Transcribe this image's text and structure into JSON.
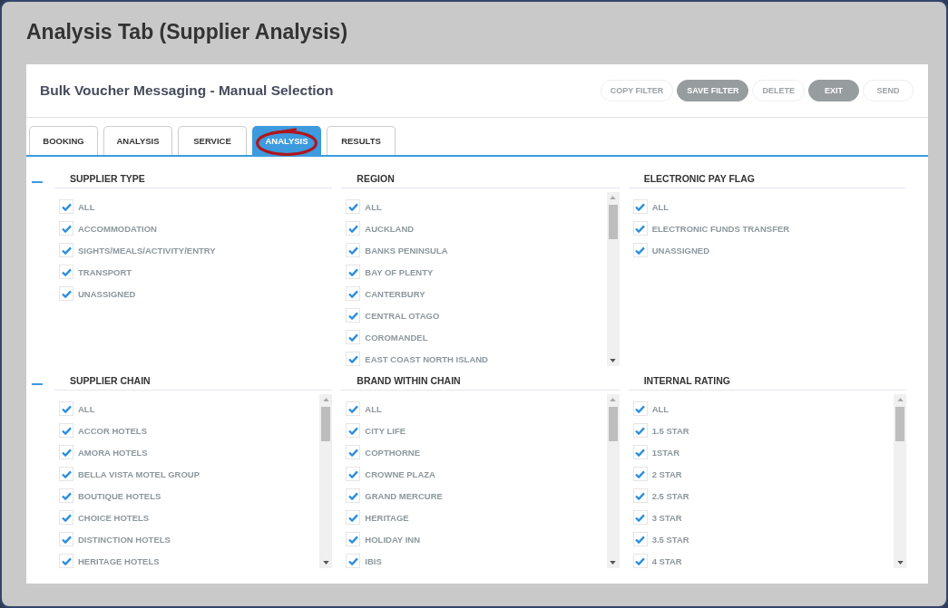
{
  "page_title": "Analysis Tab (Supplier Analysis)",
  "header": {
    "title": "Bulk Voucher Messaging - Manual Selection",
    "buttons": [
      {
        "label": "COPY FILTER",
        "disabled": true
      },
      {
        "label": "SAVE FILTER",
        "disabled": false
      },
      {
        "label": "DELETE",
        "disabled": true
      },
      {
        "label": "EXIT",
        "disabled": false
      },
      {
        "label": "SEND",
        "disabled": true
      }
    ]
  },
  "tabs": [
    {
      "label": "BOOKING",
      "selected": false,
      "circled": false
    },
    {
      "label": "ANALYSIS",
      "selected": false,
      "circled": false
    },
    {
      "label": "SERVICE",
      "selected": false,
      "circled": false
    },
    {
      "label": "ANALYSIS",
      "selected": true,
      "circled": true
    },
    {
      "label": "RESULTS",
      "selected": false,
      "circled": false
    }
  ],
  "sections": [
    {
      "expanded": true,
      "groups": [
        {
          "title": "SUPPLIER TYPE",
          "scrollable": false,
          "items": [
            {
              "label": "ALL",
              "checked": true
            },
            {
              "label": "ACCOMMODATION",
              "checked": true
            },
            {
              "label": "SIGHTS/MEALS/ACTIVITY/ENTRY",
              "checked": true
            },
            {
              "label": "TRANSPORT",
              "checked": true
            },
            {
              "label": "UNASSIGNED",
              "checked": true
            }
          ]
        },
        {
          "title": "REGION",
          "scrollable": true,
          "items": [
            {
              "label": "ALL",
              "checked": true
            },
            {
              "label": "AUCKLAND",
              "checked": true
            },
            {
              "label": "BANKS PENINSULA",
              "checked": true
            },
            {
              "label": "BAY OF PLENTY",
              "checked": true
            },
            {
              "label": "CANTERBURY",
              "checked": true
            },
            {
              "label": "CENTRAL OTAGO",
              "checked": true
            },
            {
              "label": "COROMANDEL",
              "checked": true
            },
            {
              "label": "EAST COAST NORTH ISLAND",
              "checked": true
            }
          ]
        },
        {
          "title": "ELECTRONIC PAY FLAG",
          "scrollable": false,
          "items": [
            {
              "label": "ALL",
              "checked": true
            },
            {
              "label": "ELECTRONIC FUNDS TRANSFER",
              "checked": true
            },
            {
              "label": "UNASSIGNED",
              "checked": true
            }
          ]
        }
      ]
    },
    {
      "expanded": true,
      "groups": [
        {
          "title": "SUPPLIER CHAIN",
          "scrollable": true,
          "items": [
            {
              "label": "ALL",
              "checked": true
            },
            {
              "label": "ACCOR HOTELS",
              "checked": true
            },
            {
              "label": "AMORA HOTELS",
              "checked": true
            },
            {
              "label": "BELLA VISTA MOTEL GROUP",
              "checked": true
            },
            {
              "label": "BOUTIQUE HOTELS",
              "checked": true
            },
            {
              "label": "CHOICE HOTELS",
              "checked": true
            },
            {
              "label": "DISTINCTION HOTELS",
              "checked": true
            },
            {
              "label": "HERITAGE HOTELS",
              "checked": true
            }
          ]
        },
        {
          "title": "BRAND WITHIN CHAIN",
          "scrollable": true,
          "items": [
            {
              "label": "ALL",
              "checked": true
            },
            {
              "label": "CITY LIFE",
              "checked": true
            },
            {
              "label": "COPTHORNE",
              "checked": true
            },
            {
              "label": "CROWNE PLAZA",
              "checked": true
            },
            {
              "label": "GRAND MERCURE",
              "checked": true
            },
            {
              "label": "HERITAGE",
              "checked": true
            },
            {
              "label": "HOLIDAY INN",
              "checked": true
            },
            {
              "label": "IBIS",
              "checked": true
            }
          ]
        },
        {
          "title": "INTERNAL RATING",
          "scrollable": true,
          "items": [
            {
              "label": "ALL",
              "checked": true
            },
            {
              "label": "1.5 STAR",
              "checked": true
            },
            {
              "label": "1STAR",
              "checked": true
            },
            {
              "label": "2 STAR",
              "checked": true
            },
            {
              "label": "2.5 STAR",
              "checked": true
            },
            {
              "label": "3 STAR",
              "checked": true
            },
            {
              "label": "3.5 STAR",
              "checked": true
            },
            {
              "label": "4 STAR",
              "checked": true
            }
          ]
        }
      ]
    }
  ]
}
